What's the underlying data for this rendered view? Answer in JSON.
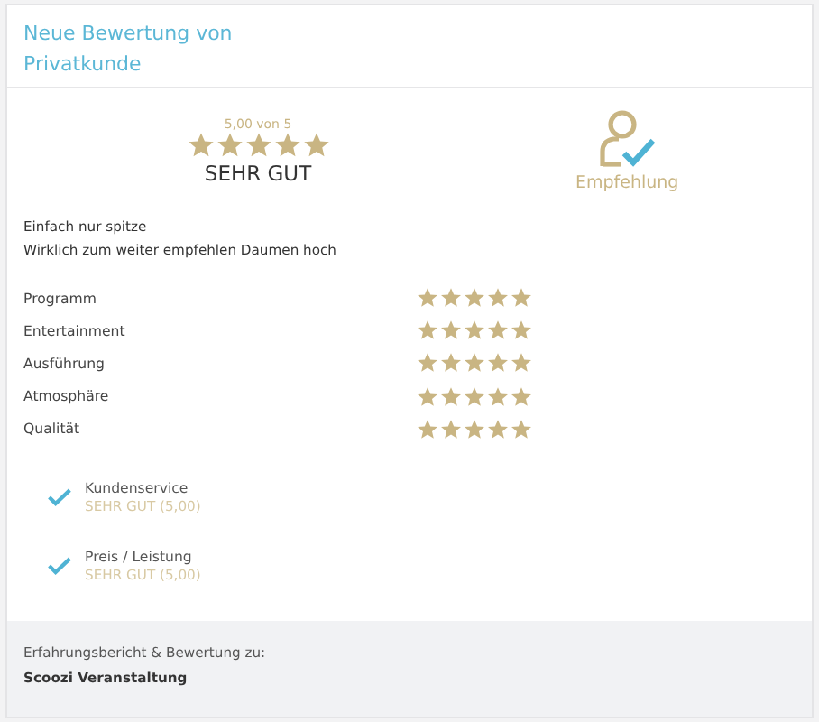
{
  "title": "Neue Bewertung von Privatkunde",
  "summary": {
    "score": "5,00 von 5",
    "stars": 5,
    "verdict": "SEHR GUT",
    "recommendation": "Empfehlung"
  },
  "comment": [
    "Einfach nur spitze",
    "Wirklich zum weiter empfehlen Daumen hoch"
  ],
  "ratings": [
    {
      "label": "Programm",
      "stars": 5
    },
    {
      "label": "Entertainment",
      "stars": 5
    },
    {
      "label": "Ausführung",
      "stars": 5
    },
    {
      "label": "Atmosphäre",
      "stars": 5
    },
    {
      "label": "Qualität",
      "stars": 5
    }
  ],
  "checks": [
    {
      "label": "Kundenservice",
      "value": "SEHR GUT (5,00)",
      "checked": true
    },
    {
      "label": "Preis / Leistung",
      "value": "SEHR GUT (5,00)",
      "checked": true
    }
  ],
  "footer": {
    "caption": "Erfahrungsbericht & Bewertung zu:",
    "subject": "Scoozi Veranstaltung"
  }
}
